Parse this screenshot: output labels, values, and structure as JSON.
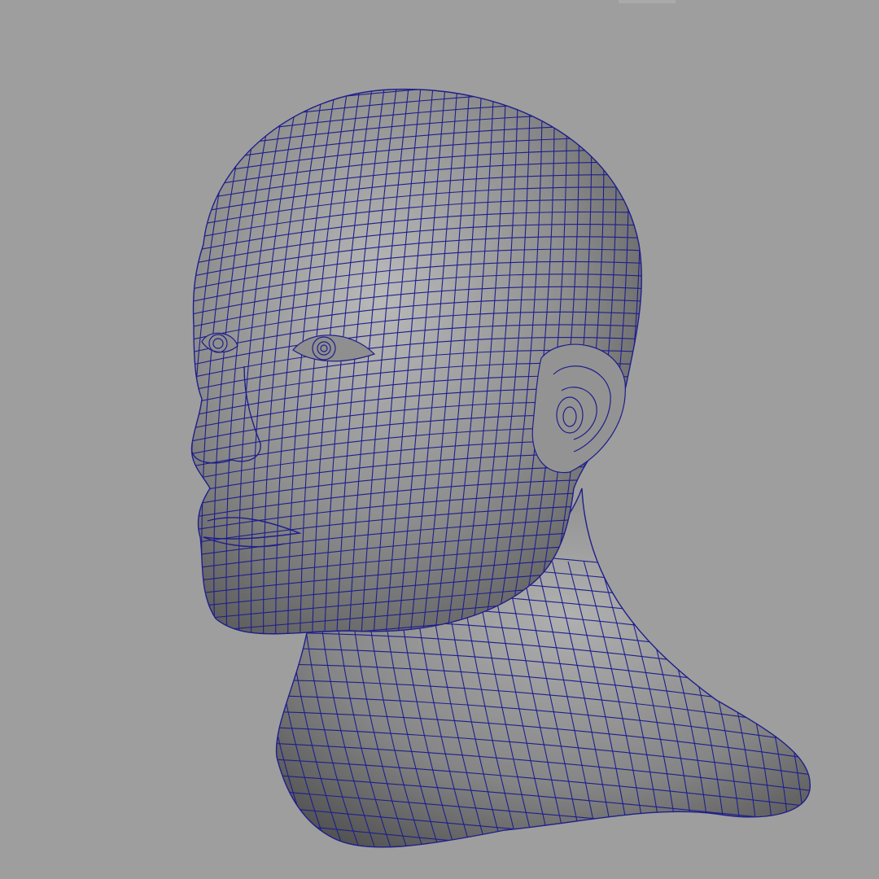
{
  "viewport": {
    "background_color": "#9e9e9e",
    "wire_color": "#1e1e8c",
    "mesh_fill_color": "#8a8a8a",
    "display_mode": "wireframe-on-shaded"
  },
  "model": {
    "icon": "head-mesh-icon"
  }
}
